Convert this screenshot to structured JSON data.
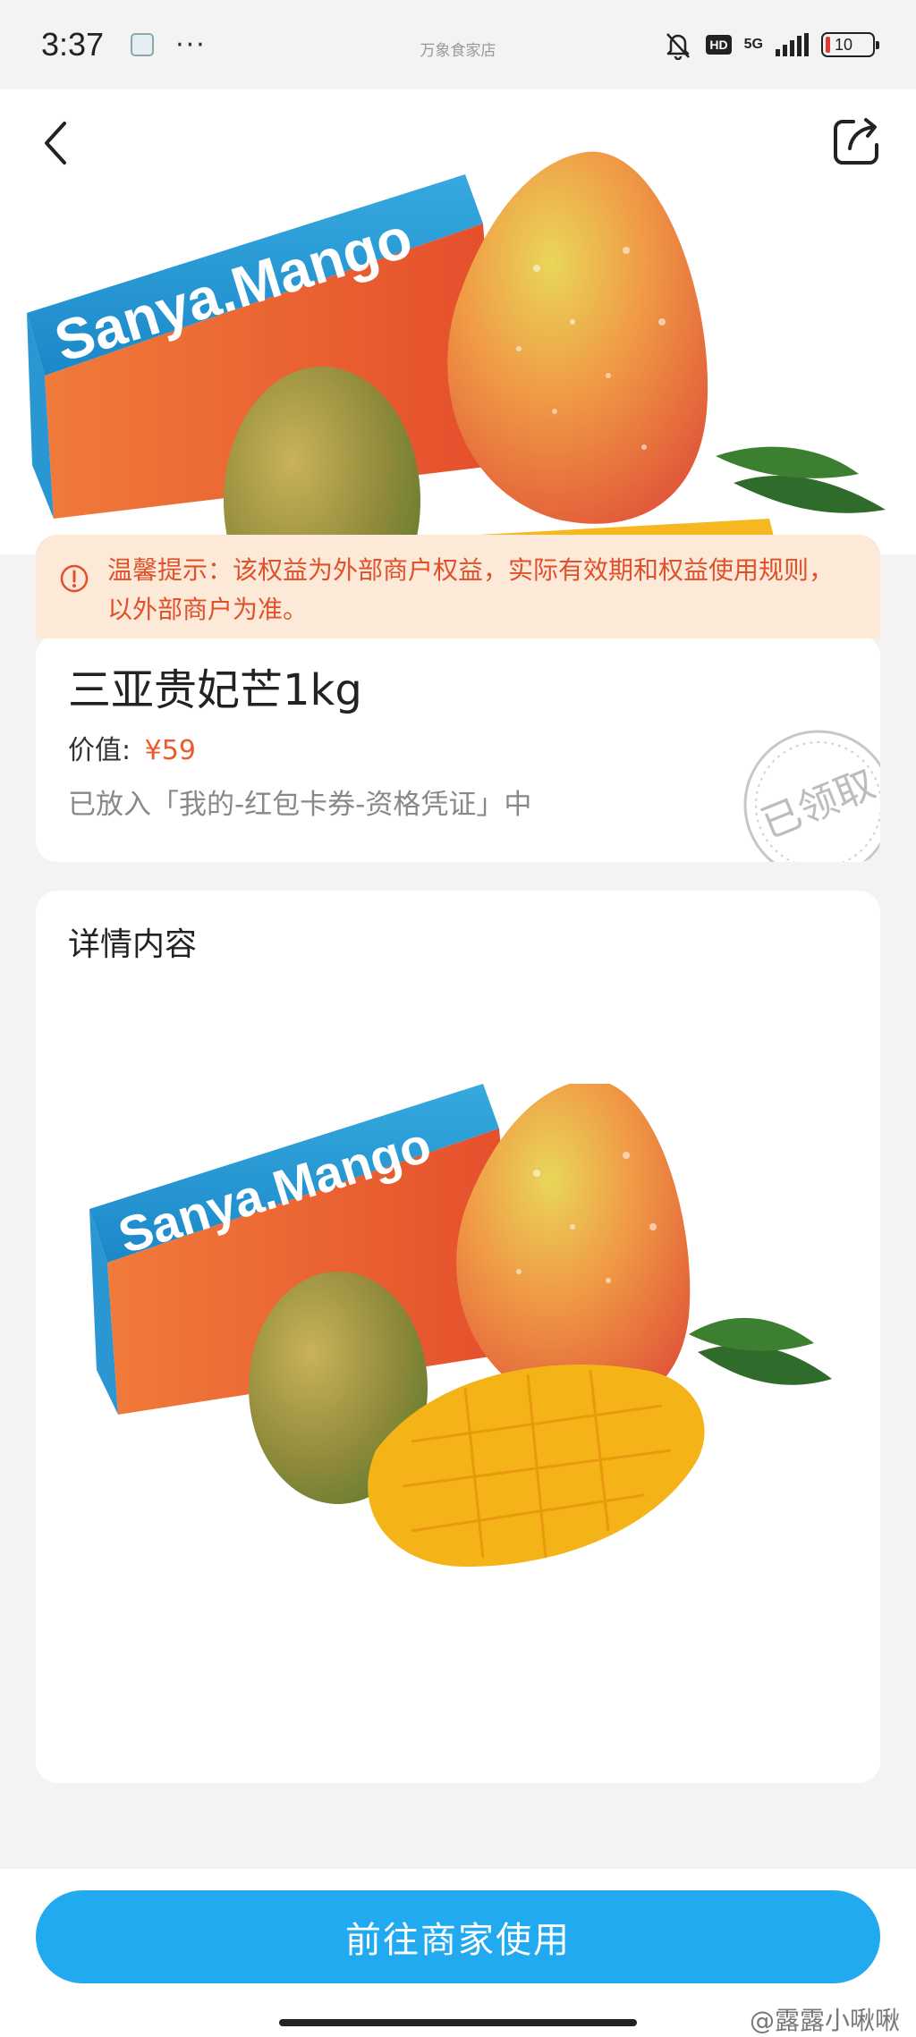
{
  "status_bar": {
    "time": "3:37",
    "dots": "···",
    "center_label": "万象食家店",
    "hd": "HD",
    "network": "5G",
    "battery": "10"
  },
  "notice": {
    "text": "温馨提示：该权益为外部商户权益，实际有效期和权益使用规则，以外部商户为准。"
  },
  "product": {
    "title": "三亚贵妃芒1kg",
    "value_label": "价值:",
    "price": "¥59",
    "location_text": "已放入「我的-红包卡券-资格凭证」中",
    "stamp_text": "已领取"
  },
  "box_brand": "Sanya.Mango",
  "detail": {
    "title": "详情内容"
  },
  "cta": {
    "label": "前往商家使用"
  },
  "watermark": "@露露小啾啾",
  "colors": {
    "accent_blue": "#22aaf1",
    "notice_bg": "#fde9d8",
    "notice_text": "#e0512b",
    "price": "#ef5a2c"
  }
}
